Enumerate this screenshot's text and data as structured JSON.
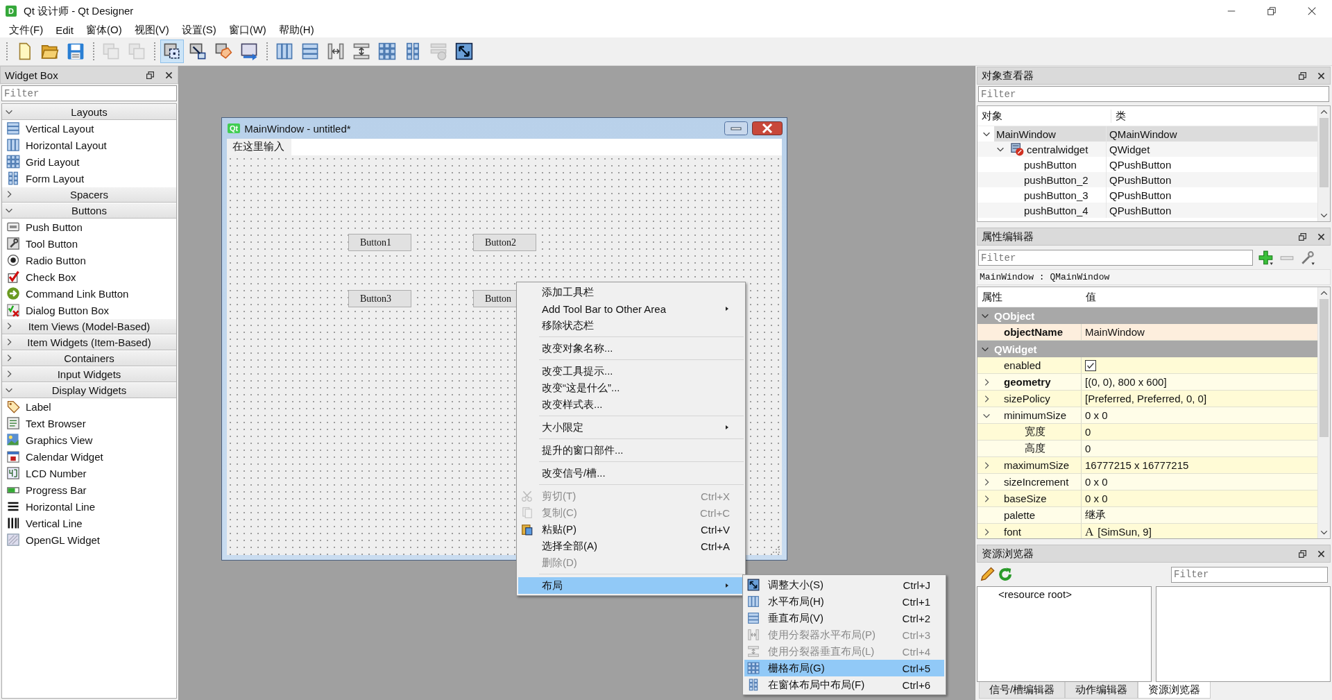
{
  "app": {
    "badge": "D",
    "title": "Qt 设计师 - Qt Designer"
  },
  "menu_bar": [
    "文件(F)",
    "Edit",
    "窗体(O)",
    "视图(V)",
    "设置(S)",
    "窗口(W)",
    "帮助(H)"
  ],
  "toolbar": [
    {
      "buttons": [
        {
          "kind": "new",
          "selected": false,
          "disabled": false
        },
        {
          "kind": "open",
          "selected": false,
          "disabled": false
        },
        {
          "kind": "save",
          "selected": false,
          "disabled": false
        }
      ]
    },
    {
      "buttons": [
        {
          "kind": "copy",
          "selected": false,
          "disabled": true
        },
        {
          "kind": "copy",
          "selected": false,
          "disabled": true
        }
      ]
    },
    {
      "buttons": [
        {
          "kind": "edit-widgets",
          "selected": true,
          "disabled": false
        },
        {
          "kind": "edit-signals",
          "selected": false,
          "disabled": false
        },
        {
          "kind": "edit-buddies",
          "selected": false,
          "disabled": false
        },
        {
          "kind": "edit-tab-order",
          "selected": false,
          "disabled": false
        }
      ]
    },
    {
      "buttons": [
        {
          "kind": "hlayout",
          "selected": false,
          "disabled": false
        },
        {
          "kind": "vlayout",
          "selected": false,
          "disabled": false
        },
        {
          "kind": "hsplit",
          "selected": false,
          "disabled": false
        },
        {
          "kind": "vsplit",
          "selected": false,
          "disabled": false
        },
        {
          "kind": "grid",
          "selected": false,
          "disabled": false
        },
        {
          "kind": "form",
          "selected": false,
          "disabled": false
        },
        {
          "kind": "break",
          "selected": false,
          "disabled": true
        },
        {
          "kind": "adjust",
          "selected": false,
          "disabled": false
        }
      ]
    }
  ],
  "widget_box": {
    "title": "Widget Box",
    "filter": {
      "placeholder": "Filter"
    },
    "categories": [
      {
        "label": "Layouts",
        "expanded": true,
        "items": [
          {
            "label": "Vertical Layout",
            "kind": "vlayout"
          },
          {
            "label": "Horizontal Layout",
            "kind": "hlayout"
          },
          {
            "label": "Grid Layout",
            "kind": "grid"
          },
          {
            "label": "Form Layout",
            "kind": "form"
          }
        ]
      },
      {
        "label": "Spacers",
        "expanded": false
      },
      {
        "label": "Buttons",
        "expanded": true,
        "items": [
          {
            "label": "Push Button",
            "kind": "push-button"
          },
          {
            "label": "Tool Button",
            "kind": "tool-button"
          },
          {
            "label": "Radio Button",
            "kind": "radio"
          },
          {
            "label": "Check Box",
            "kind": "check"
          },
          {
            "label": "Command Link Button",
            "kind": "command-link"
          },
          {
            "label": "Dialog Button Box",
            "kind": "dialog-buttons"
          }
        ]
      },
      {
        "label": "Item Views (Model-Based)",
        "expanded": false
      },
      {
        "label": "Item Widgets (Item-Based)",
        "expanded": false
      },
      {
        "label": "Containers",
        "expanded": false
      },
      {
        "label": "Input Widgets",
        "expanded": false
      },
      {
        "label": "Display Widgets",
        "expanded": true,
        "items": [
          {
            "label": "Label",
            "kind": "label"
          },
          {
            "label": "Text Browser",
            "kind": "text-browser"
          },
          {
            "label": "Graphics View",
            "kind": "graphics-view"
          },
          {
            "label": "Calendar Widget",
            "kind": "calendar"
          },
          {
            "label": "LCD Number",
            "kind": "lcd"
          },
          {
            "label": "Progress Bar",
            "kind": "progress"
          },
          {
            "label": "Horizontal Line",
            "kind": "hline"
          },
          {
            "label": "Vertical Line",
            "kind": "vline"
          },
          {
            "label": "OpenGL Widget",
            "kind": "opengl"
          }
        ]
      }
    ]
  },
  "form": {
    "badge": "Qt",
    "title": "MainWindow - untitled*",
    "menu_placeholder": "在这里输入",
    "buttons": [
      "Button1",
      "Button2",
      "Button3",
      "Button"
    ]
  },
  "context_menu": [
    {
      "kind": "item",
      "label": "添加工具栏",
      "disabled": false,
      "selected": false,
      "submenu": false
    },
    {
      "kind": "item",
      "label": "Add Tool Bar to Other Area",
      "disabled": false,
      "selected": false,
      "submenu": true
    },
    {
      "kind": "item",
      "label": "移除状态栏",
      "disabled": false,
      "selected": false,
      "submenu": false
    },
    {
      "kind": "separator"
    },
    {
      "kind": "item",
      "label": "改变对象名称...",
      "disabled": false,
      "selected": false,
      "submenu": false
    },
    {
      "kind": "separator"
    },
    {
      "kind": "item",
      "label": "改变工具提示...",
      "disabled": false,
      "selected": false,
      "submenu": false
    },
    {
      "kind": "item",
      "label": "改变“这是什么”...",
      "disabled": false,
      "selected": false,
      "submenu": false
    },
    {
      "kind": "item",
      "label": "改变样式表...",
      "disabled": false,
      "selected": false,
      "submenu": false
    },
    {
      "kind": "separator"
    },
    {
      "kind": "item",
      "label": "大小限定",
      "disabled": false,
      "selected": false,
      "submenu": true
    },
    {
      "kind": "separator"
    },
    {
      "kind": "item",
      "label": "提升的窗口部件...",
      "disabled": false,
      "selected": false,
      "submenu": false
    },
    {
      "kind": "separator"
    },
    {
      "kind": "item",
      "label": "改变信号/槽...",
      "disabled": false,
      "selected": false,
      "submenu": false
    },
    {
      "kind": "separator"
    },
    {
      "kind": "cut",
      "label": "剪切(T)",
      "shortcut": "Ctrl+X",
      "disabled": true,
      "selected": false,
      "submenu": false
    },
    {
      "kind": "copy-doc",
      "label": "复制(C)",
      "shortcut": "Ctrl+C",
      "disabled": true,
      "selected": false,
      "submenu": false
    },
    {
      "kind": "paste",
      "label": "粘贴(P)",
      "shortcut": "Ctrl+V",
      "disabled": false,
      "selected": false,
      "submenu": false
    },
    {
      "kind": "item",
      "label": "选择全部(A)",
      "shortcut": "Ctrl+A",
      "disabled": false,
      "selected": false,
      "submenu": false
    },
    {
      "kind": "item",
      "label": "删除(D)",
      "disabled": true,
      "selected": false,
      "submenu": false
    },
    {
      "kind": "separator"
    },
    {
      "kind": "item",
      "label": "布局",
      "disabled": false,
      "selected": true,
      "submenu": true
    }
  ],
  "layout_submenu": [
    {
      "kind": "adjust",
      "label": "调整大小(S)",
      "shortcut": "Ctrl+J",
      "disabled": false,
      "selected": false
    },
    {
      "kind": "hlayout",
      "label": "水平布局(H)",
      "shortcut": "Ctrl+1",
      "disabled": false,
      "selected": false
    },
    {
      "kind": "vlayout",
      "label": "垂直布局(V)",
      "shortcut": "Ctrl+2",
      "disabled": false,
      "selected": false
    },
    {
      "kind": "hsplit",
      "label": "使用分裂器水平布局(P)",
      "shortcut": "Ctrl+3",
      "disabled": true,
      "selected": false
    },
    {
      "kind": "vsplit",
      "label": "使用分裂器垂直布局(L)",
      "shortcut": "Ctrl+4",
      "disabled": true,
      "selected": false
    },
    {
      "kind": "grid",
      "label": "栅格布局(G)",
      "shortcut": "Ctrl+5",
      "disabled": false,
      "selected": true
    },
    {
      "kind": "form",
      "label": "在窗体布局中布局(F)",
      "shortcut": "Ctrl+6",
      "disabled": false,
      "selected": false
    }
  ],
  "object_inspector": {
    "title": "对象查看器",
    "filter": {
      "placeholder": "Filter"
    },
    "columns": [
      "对象",
      "类"
    ],
    "tree": [
      {
        "name": "MainWindow",
        "class": "QMainWindow",
        "expanded": true,
        "selected": true,
        "children": [
          {
            "name": "centralwidget",
            "class": "QWidget",
            "kind": "widget",
            "expanded": true,
            "selected": false,
            "children": [
              {
                "name": "pushButton",
                "class": "QPushButton",
                "selected": false
              },
              {
                "name": "pushButton_2",
                "class": "QPushButton",
                "selected": false
              },
              {
                "name": "pushButton_3",
                "class": "QPushButton",
                "selected": false
              },
              {
                "name": "pushButton_4",
                "class": "QPushButton",
                "selected": false
              }
            ]
          }
        ]
      }
    ]
  },
  "property_editor": {
    "title": "属性编辑器",
    "filter": {
      "placeholder": "Filter"
    },
    "object_label": "MainWindow : QMainWindow",
    "columns": [
      "属性",
      "值"
    ],
    "groups": [
      {
        "name": "QObject",
        "expanded": true,
        "properties": [
          {
            "name": "objectName",
            "kind": "text",
            "value": "MainWindow",
            "modified": true
          }
        ]
      },
      {
        "name": "QWidget",
        "expanded": true,
        "properties": [
          {
            "name": "enabled",
            "kind": "checkbox",
            "checked": true,
            "modified": false
          },
          {
            "name": "geometry",
            "kind": "text",
            "value": "[(0, 0), 800 x 600]",
            "modified": true,
            "expanded": false
          },
          {
            "name": "sizePolicy",
            "kind": "text",
            "value": "[Preferred, Preferred, 0, 0]",
            "modified": false,
            "expanded": false
          },
          {
            "name": "minimumSize",
            "kind": "text",
            "value": "0 x 0",
            "modified": false,
            "expanded": true,
            "children": [
              {
                "name": "宽度",
                "kind": "text",
                "value": "0",
                "modified": false
              },
              {
                "name": "高度",
                "kind": "text",
                "value": "0",
                "modified": false
              }
            ]
          },
          {
            "name": "maximumSize",
            "kind": "text",
            "value": "16777215 x 16777215",
            "modified": false,
            "expanded": false
          },
          {
            "name": "sizeIncrement",
            "kind": "text",
            "value": "0 x 0",
            "modified": false,
            "expanded": false
          },
          {
            "name": "baseSize",
            "kind": "text",
            "value": "0 x 0",
            "modified": false,
            "expanded": false
          },
          {
            "name": "palette",
            "kind": "text",
            "value": "继承",
            "modified": false
          },
          {
            "name": "font",
            "kind": "font",
            "glyph": "A",
            "value": "[SimSun, 9]",
            "modified": false,
            "expanded": false
          }
        ]
      }
    ]
  },
  "resource_browser": {
    "title": "资源浏览器",
    "filter": {
      "placeholder": "Filter"
    },
    "root": "<resource root>"
  },
  "bottom_tabs": [
    {
      "label": "信号/槽编辑器",
      "selected": false
    },
    {
      "label": "动作编辑器",
      "selected": false
    },
    {
      "label": "资源浏览器",
      "selected": true
    }
  ]
}
